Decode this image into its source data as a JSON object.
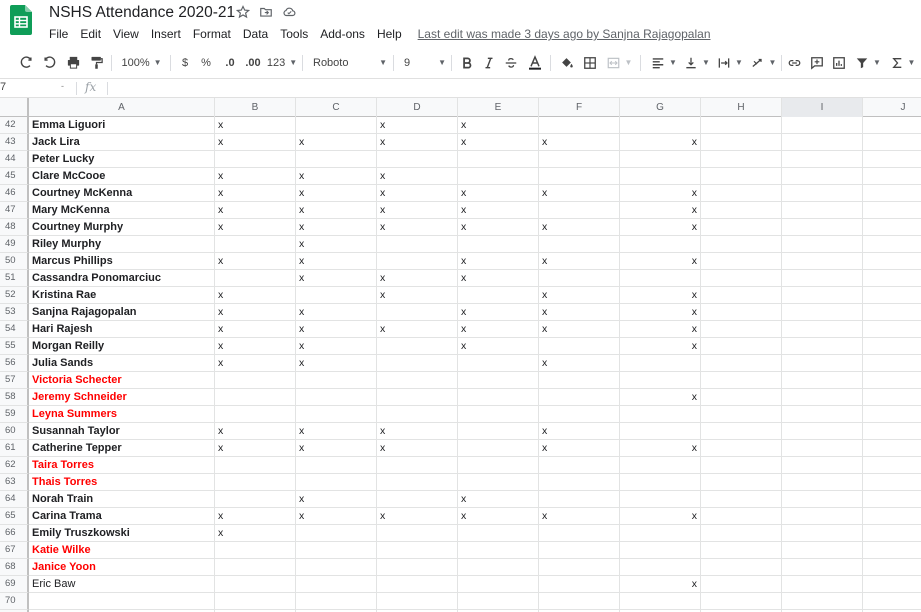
{
  "app": {
    "title": "NSHS Attendance 2020-21",
    "last_edit": "Last edit was made 3 days ago by Sanjna Rajagopalan",
    "accent_green": "#0f9d58"
  },
  "menu": [
    "File",
    "Edit",
    "View",
    "Insert",
    "Format",
    "Data",
    "Tools",
    "Add-ons",
    "Help"
  ],
  "toolbar": {
    "zoom": "100%",
    "currency": "$",
    "percent": "%",
    "decrease_decimals": ".0",
    "increase_decimals": ".00",
    "more_formats": "123",
    "font": "Roboto",
    "font_size": "9"
  },
  "formula_bar": {
    "name_box": "7",
    "name_box_caret": "-",
    "fx": "fx"
  },
  "columns": [
    "A",
    "B",
    "C",
    "D",
    "E",
    "F",
    "G",
    "H",
    "I",
    "J"
  ],
  "selected_column": "I",
  "rows": [
    {
      "num": "42",
      "name": "Emma Liguori",
      "style": "bold",
      "marks": {
        "B": "x",
        "D": "x",
        "E": "x"
      }
    },
    {
      "num": "43",
      "name": "Jack Lira",
      "style": "bold",
      "marks": {
        "B": "x",
        "C": "x",
        "D": "x",
        "E": "x",
        "F": "x",
        "G": "x"
      }
    },
    {
      "num": "44",
      "name": "Peter Lucky",
      "style": "bold",
      "marks": {}
    },
    {
      "num": "45",
      "name": "Clare McCooe",
      "style": "bold",
      "marks": {
        "B": "x",
        "C": "x",
        "D": "x"
      }
    },
    {
      "num": "46",
      "name": "Courtney McKenna",
      "style": "bold",
      "marks": {
        "B": "x",
        "C": "x",
        "D": "x",
        "E": "x",
        "F": "x",
        "G": "x"
      }
    },
    {
      "num": "47",
      "name": "Mary McKenna",
      "style": "bold",
      "marks": {
        "B": "x",
        "C": "x",
        "D": "x",
        "E": "x",
        "G": "x"
      }
    },
    {
      "num": "48",
      "name": "Courtney Murphy",
      "style": "bold",
      "marks": {
        "B": "x",
        "C": "x",
        "D": "x",
        "E": "x",
        "F": "x",
        "G": "x"
      }
    },
    {
      "num": "49",
      "name": "Riley Murphy",
      "style": "bold",
      "marks": {
        "C": "x"
      }
    },
    {
      "num": "50",
      "name": "Marcus Phillips",
      "style": "bold",
      "marks": {
        "B": "x",
        "C": "x",
        "E": "x",
        "F": "x",
        "G": "x"
      }
    },
    {
      "num": "51",
      "name": "Cassandra Ponomarciuc",
      "style": "bold",
      "marks": {
        "C": "x",
        "D": "x",
        "E": "x"
      }
    },
    {
      "num": "52",
      "name": "Kristina Rae",
      "style": "bold",
      "marks": {
        "B": "x",
        "D": "x",
        "F": "x",
        "G": "x"
      }
    },
    {
      "num": "53",
      "name": "Sanjna Rajagopalan",
      "style": "bold",
      "marks": {
        "B": "x",
        "C": "x",
        "E": "x",
        "F": "x",
        "G": "x"
      }
    },
    {
      "num": "54",
      "name": "Hari Rajesh",
      "style": "bold",
      "marks": {
        "B": "x",
        "C": "x",
        "D": "x",
        "E": "x",
        "F": "x",
        "G": "x"
      }
    },
    {
      "num": "55",
      "name": "Morgan Reilly",
      "style": "bold",
      "marks": {
        "B": "x",
        "C": "x",
        "E": "x",
        "G": "x"
      }
    },
    {
      "num": "56",
      "name": "Julia Sands",
      "style": "bold",
      "marks": {
        "B": "x",
        "C": "x",
        "F": "x"
      }
    },
    {
      "num": "57",
      "name": "Victoria Schecter",
      "style": "red",
      "marks": {}
    },
    {
      "num": "58",
      "name": "Jeremy Schneider",
      "style": "red",
      "marks": {
        "G": "x"
      }
    },
    {
      "num": "59",
      "name": "Leyna Summers",
      "style": "red",
      "marks": {}
    },
    {
      "num": "60",
      "name": "Susannah Taylor",
      "style": "bold",
      "marks": {
        "B": "x",
        "C": "x",
        "D": "x",
        "F": "x"
      }
    },
    {
      "num": "61",
      "name": "Catherine Tepper",
      "style": "bold",
      "marks": {
        "B": "x",
        "C": "x",
        "D": "x",
        "F": "x",
        "G": "x"
      }
    },
    {
      "num": "62",
      "name": "Taira Torres",
      "style": "red",
      "marks": {}
    },
    {
      "num": "63",
      "name": "Thais Torres",
      "style": "red",
      "marks": {}
    },
    {
      "num": "64",
      "name": "Norah Train",
      "style": "bold",
      "marks": {
        "C": "x",
        "E": "x"
      }
    },
    {
      "num": "65",
      "name": "Carina Trama",
      "style": "bold",
      "marks": {
        "B": "x",
        "C": "x",
        "D": "x",
        "E": "x",
        "F": "x",
        "G": "x"
      }
    },
    {
      "num": "66",
      "name": "Emily Truszkowski",
      "style": "bold",
      "marks": {
        "B": "x"
      }
    },
    {
      "num": "67",
      "name": "Katie Wilke",
      "style": "red",
      "marks": {}
    },
    {
      "num": "68",
      "name": "Janice Yoon",
      "style": "red",
      "marks": {}
    },
    {
      "num": "69",
      "name": "Eric Baw",
      "style": "plain",
      "marks": {
        "G": "x"
      }
    },
    {
      "num": "70",
      "name": "",
      "style": "plain",
      "marks": {}
    },
    {
      "num": "71",
      "name": "",
      "style": "plain",
      "marks": {}
    }
  ]
}
